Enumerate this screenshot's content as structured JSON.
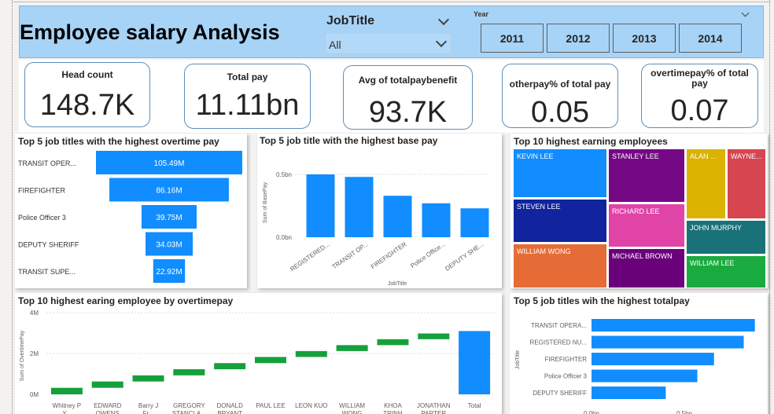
{
  "header": {
    "title": "Employee salary Analysis",
    "jobtitle_slicer": {
      "label": "JobTitle",
      "value": "All"
    },
    "year_slicer": {
      "label": "Year",
      "options": [
        "2011",
        "2012",
        "2013",
        "2014"
      ]
    }
  },
  "kpis": [
    {
      "label": "Head count",
      "value": "148.7K"
    },
    {
      "label": "Total pay",
      "value": "11.11bn"
    },
    {
      "label": "Avg of totalpaybenefit",
      "value": "93.7K"
    },
    {
      "label": "otherpay% of total pay",
      "value": "0.05"
    },
    {
      "label": "overtimepay% of total pay",
      "value": "0.07"
    }
  ],
  "colors": {
    "bar_blue": "#118dff",
    "waterfall_green": "#15a03c",
    "header_bg": "#a7d3f7",
    "treemap": [
      "#118dff",
      "#750985",
      "#d9b300",
      "#d64550",
      "#12239e",
      "#e044a7",
      "#197278",
      "#e66c37",
      "#6b007b",
      "#1aab40"
    ]
  },
  "panels": {
    "overtime_funnel": {
      "title": "Top 5 job titles with the highest overtime pay"
    },
    "basepay": {
      "title": "Top 5 job title with the highest base pay"
    },
    "treemap": {
      "title": "Top 10 highest earning employees"
    },
    "waterfall": {
      "title": "Top 10 highest earing employee by overtimepay"
    },
    "totalpay": {
      "title": "Top 5 job titles wih the highest totalpay"
    }
  },
  "chart_data": [
    {
      "type": "bar",
      "orientation": "horizontal-funnel",
      "title": "Top 5 job titles with the highest overtime pay",
      "categories": [
        "TRANSIT OPER...",
        "FIREFIGHTER",
        "Police Officer 3",
        "DEPUTY SHERIFF",
        "TRANSIT SUPE..."
      ],
      "values": [
        105.49,
        86.16,
        39.75,
        34.03,
        22.92
      ],
      "data_labels": [
        "105.49M",
        "86.16M",
        "39.75M",
        "34.03M",
        "22.92M"
      ],
      "unit": "M"
    },
    {
      "type": "bar",
      "title": "Top 5 job title with the highest base pay",
      "categories": [
        "REGISTERED...",
        "TRANSIT OP...",
        "FIREFIGHTER",
        "Police Office...",
        "DEPUTY SHE..."
      ],
      "values": [
        0.5,
        0.48,
        0.33,
        0.27,
        0.23
      ],
      "xlabel": "JobTitle",
      "ylabel": "Sum of BasePay",
      "yticks": [
        "0.0bn",
        "0.5bn"
      ],
      "ylim": [
        0,
        0.6
      ],
      "unit": "bn"
    },
    {
      "type": "treemap",
      "title": "Top 10 highest earning employees",
      "labels": [
        "KEVIN LEE",
        "STANLEY LEE",
        "ALAN ...",
        "WAYNE...",
        "STEVEN LEE",
        "RICHARD LEE",
        "JOHN MURPHY",
        "WILLIAM WONG",
        "MICHAEL BROWN",
        "WILLIAM LEE"
      ]
    },
    {
      "type": "waterfall",
      "title": "Top 10 highest earing employee by overtimepay",
      "categories": [
        "Whitney P Y...",
        "EDWARD OWENS",
        "Barry J Fr...",
        "GREGORY STANCLA...",
        "DONALD BRYANT",
        "PAUL LEE",
        "LEON KUO",
        "WILLIAM WONG",
        "KHOA TRINH",
        "JONATHAN PARTER",
        "Total"
      ],
      "tick_labels": [
        "Whitney P\nY...",
        "EDWARD\nOWENS",
        "Barry J\nFr...",
        "GREGORY\nSTANCLA...",
        "DONALD\nBRYANT",
        "PAUL LEE",
        "LEON KUO",
        "WILLIAM\nWONG",
        "KHOA\nTRINH",
        "JONATHAN\nPARTER",
        "Total"
      ],
      "values": [
        0.32,
        0.31,
        0.3,
        0.3,
        0.3,
        0.3,
        0.29,
        0.29,
        0.29,
        0.28
      ],
      "total": 3.1,
      "ylabel": "Sum of OvertimePay",
      "yticks": [
        "0M",
        "2M",
        "4M"
      ],
      "ylim": [
        0,
        4
      ],
      "unit": "M"
    },
    {
      "type": "bar",
      "orientation": "horizontal",
      "title": "Top 5 job titles wih the highest totalpay",
      "categories": [
        "TRANSIT OPERA...",
        "REGISTERED NU...",
        "FIREFIGHTER",
        "Police Officer 3",
        "DEPUTY SHERIFF"
      ],
      "values": [
        0.88,
        0.82,
        0.66,
        0.57,
        0.4
      ],
      "ylabel": "JobTitle",
      "xticks": [
        "0.0bn",
        "0.5bn"
      ],
      "xlim": [
        0,
        1.0
      ],
      "unit": "bn"
    }
  ]
}
